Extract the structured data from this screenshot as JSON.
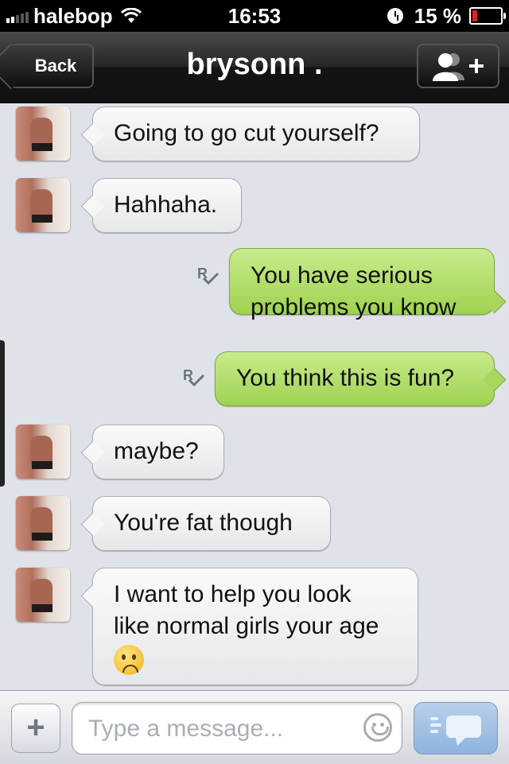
{
  "status_bar": {
    "carrier": "halebop",
    "time": "16:53",
    "battery": "15 %"
  },
  "nav": {
    "back_label": "Back",
    "title": "brysonn ."
  },
  "messages": [
    {
      "side": "incoming",
      "text": "Going to go cut yourself?"
    },
    {
      "side": "incoming",
      "text": "Hahhaha."
    },
    {
      "side": "outgoing",
      "lines": [
        "You have serious",
        "problems you know"
      ],
      "read_receipt": "R"
    },
    {
      "side": "outgoing",
      "text": "You think this is fun?",
      "read_receipt": "R"
    },
    {
      "side": "incoming",
      "text": "maybe?"
    },
    {
      "side": "incoming",
      "text": "You're fat though"
    },
    {
      "side": "incoming",
      "lines": [
        "I want to help you look",
        "like normal girls your age"
      ],
      "emoji": "worried-face"
    }
  ],
  "input": {
    "placeholder": "Type a message...",
    "value": ""
  },
  "colors": {
    "incoming_bubble": "#f2f3f5",
    "outgoing_bubble": "#b5e070",
    "background": "#dfe3e9",
    "send_button": "#9fbfe4"
  },
  "icons": [
    "wifi-icon",
    "alarm-icon",
    "battery-icon",
    "add-contact-icon",
    "read-receipt-icon",
    "plus-icon",
    "smiley-icon",
    "send-icon"
  ]
}
